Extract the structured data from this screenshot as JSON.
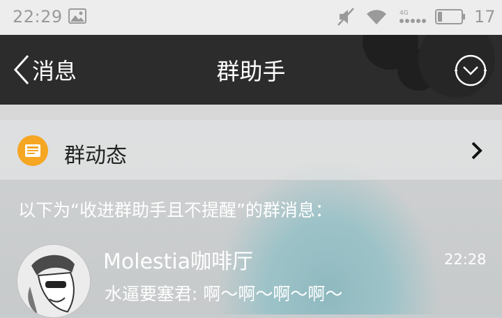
{
  "status_bar": {
    "time": "22:29",
    "network_type": "4G",
    "battery_level": "17",
    "icons": [
      "image-icon",
      "mute-icon",
      "wifi-icon",
      "signal-icon",
      "battery-icon"
    ]
  },
  "header": {
    "back_label": "消息",
    "title": "群助手",
    "menu_icon": "chevron-circle-icon"
  },
  "group_dynamics": {
    "label": "群动态",
    "icon": "news-icon",
    "accent_color": "#f5a623"
  },
  "notice_text": "以下为“收进群助手且不提醒”的群消息：",
  "chats": [
    {
      "name": "Molestia咖啡厅",
      "time": "22:28",
      "last_message": "水逼要塞君: 啊～啊～啊～啊～"
    }
  ]
}
